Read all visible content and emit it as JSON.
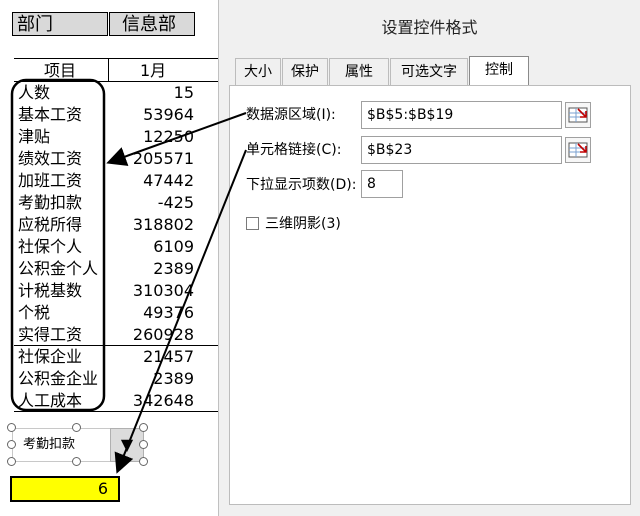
{
  "sheet": {
    "header": {
      "dept_label": "部门",
      "dept_value": "信息部"
    },
    "columns": {
      "item": "项目",
      "month": "1月"
    },
    "rows": [
      {
        "label": "人数",
        "value": "15"
      },
      {
        "label": "基本工资",
        "value": "53964"
      },
      {
        "label": "津贴",
        "value": "12250"
      },
      {
        "label": "绩效工资",
        "value": "205571"
      },
      {
        "label": "加班工资",
        "value": "47442"
      },
      {
        "label": "考勤扣款",
        "value": "-425"
      },
      {
        "label": "应税所得",
        "value": "318802"
      },
      {
        "label": "社保个人",
        "value": "6109"
      },
      {
        "label": "公积金个人",
        "value": "2389"
      },
      {
        "label": "计税基数",
        "value": "310304"
      },
      {
        "label": "个税",
        "value": "49376"
      },
      {
        "label": "实得工资",
        "value": "260928"
      },
      {
        "label": "社保企业",
        "value": "21457"
      },
      {
        "label": "公积金企业",
        "value": "2389"
      },
      {
        "label": "人工成本",
        "value": "342648"
      }
    ],
    "combo": {
      "selected": "考勤扣款",
      "arrow": "▼"
    },
    "linked_cell_value": "6"
  },
  "dialog": {
    "title": "设置控件格式",
    "tabs": [
      "大小",
      "保护",
      "属性",
      "可选文字",
      "控制"
    ],
    "active_tab": "控制",
    "input_range": {
      "label": "数据源区域(I):",
      "value": "$B$5:$B$19"
    },
    "cell_link": {
      "label": "单元格链接(C):",
      "value": "$B$23"
    },
    "drop_down_lines": {
      "label": "下拉显示项数(D):",
      "value": "8"
    },
    "shading_3d": {
      "label": "三维阴影(3)",
      "checked": false
    }
  },
  "colors": {
    "header_fill": "#d9d9d9",
    "linked_cell_fill": "#ffff00",
    "dialog_bg": "#f0f0f0"
  },
  "icons": [
    "range-select-icon",
    "dropdown-arrow-icon"
  ]
}
